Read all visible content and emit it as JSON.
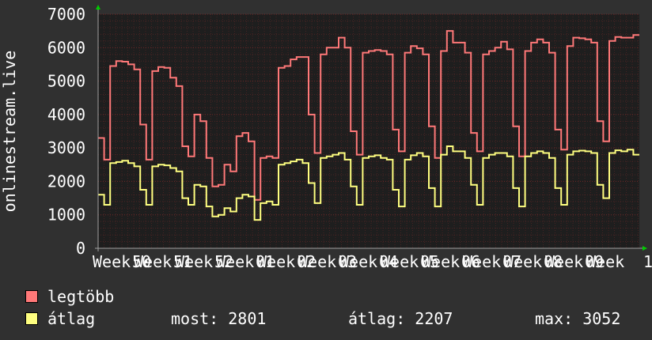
{
  "chart_data": {
    "type": "line",
    "ylabel": "onlinestream.live",
    "ylim": [
      0,
      7000
    ],
    "yticks": [
      0,
      1000,
      2000,
      3000,
      4000,
      5000,
      6000,
      7000
    ],
    "x_tick_labels": [
      "Week 50",
      "Week 51",
      "Week 52",
      "Week 01",
      "Week 02",
      "Week 03",
      "Week 04",
      "Week 05",
      "Week 06",
      "Week 07",
      "Week 08",
      "Week 09",
      "Week 1"
    ],
    "x_tick_labels_rendered": [
      "Week",
      "50",
      "Week",
      "51",
      "Week",
      "52",
      "Week",
      "01",
      "Week",
      "02",
      "Week",
      "03",
      "Week",
      "04",
      "Week",
      "05",
      "Week",
      "06",
      "Week",
      "07",
      "Week",
      "08",
      "Week",
      "09",
      "Week",
      "1"
    ],
    "grid": true,
    "background": "#1e1e1e",
    "grid_color": "#7a2a2a",
    "axis_color": "#a0a0a0",
    "arrow_color": "#00cc00",
    "series": [
      {
        "name": "legtöbb",
        "color": "#ff7878",
        "values": [
          3300,
          2650,
          5450,
          5600,
          5580,
          5500,
          5350,
          3700,
          2650,
          5300,
          5420,
          5400,
          5100,
          4850,
          3050,
          2750,
          4000,
          3800,
          2700,
          1850,
          1900,
          2500,
          2300,
          3350,
          3450,
          3200,
          1450,
          2700,
          2750,
          2700,
          5400,
          5450,
          5650,
          5720,
          5720,
          4000,
          2850,
          5800,
          6000,
          6000,
          6300,
          6000,
          3500,
          2800,
          5850,
          5900,
          5930,
          5900,
          5800,
          3550,
          2900,
          5850,
          6050,
          5980,
          5800,
          3650,
          2700,
          5900,
          6500,
          6150,
          6150,
          5850,
          3450,
          2900,
          5800,
          5900,
          6000,
          6180,
          5950,
          3650,
          2750,
          5900,
          6150,
          6250,
          6150,
          5850,
          3550,
          2950,
          6050,
          6300,
          6280,
          6250,
          6150,
          3800,
          3200,
          6200,
          6320,
          6300,
          6300,
          6380
        ]
      },
      {
        "name": "átlag",
        "color": "#ffff80",
        "values": [
          1600,
          1300,
          2550,
          2580,
          2620,
          2550,
          2450,
          1750,
          1300,
          2450,
          2500,
          2480,
          2400,
          2300,
          1500,
          1300,
          1900,
          1850,
          1250,
          950,
          1000,
          1200,
          1100,
          1500,
          1600,
          1550,
          850,
          1350,
          1400,
          1300,
          2500,
          2550,
          2600,
          2650,
          2550,
          1950,
          1350,
          2700,
          2750,
          2800,
          2850,
          2650,
          1850,
          1300,
          2700,
          2750,
          2780,
          2700,
          2650,
          1750,
          1250,
          2650,
          2780,
          2850,
          2750,
          1800,
          1250,
          2800,
          3050,
          2900,
          2900,
          2700,
          1900,
          1300,
          2700,
          2800,
          2850,
          2850,
          2750,
          1800,
          1250,
          2750,
          2850,
          2900,
          2850,
          2700,
          1800,
          1300,
          2800,
          2900,
          2920,
          2900,
          2850,
          1900,
          1500,
          2850,
          2930,
          2900,
          2950,
          2800
        ]
      }
    ]
  },
  "legend": [
    {
      "label": "legtöbb",
      "color": "#ff7878"
    },
    {
      "label": "átlag",
      "color": "#ffff80"
    }
  ],
  "stats": {
    "most": "most: 2801",
    "atlag": "átlag: 2207",
    "max": "max: 3052"
  }
}
